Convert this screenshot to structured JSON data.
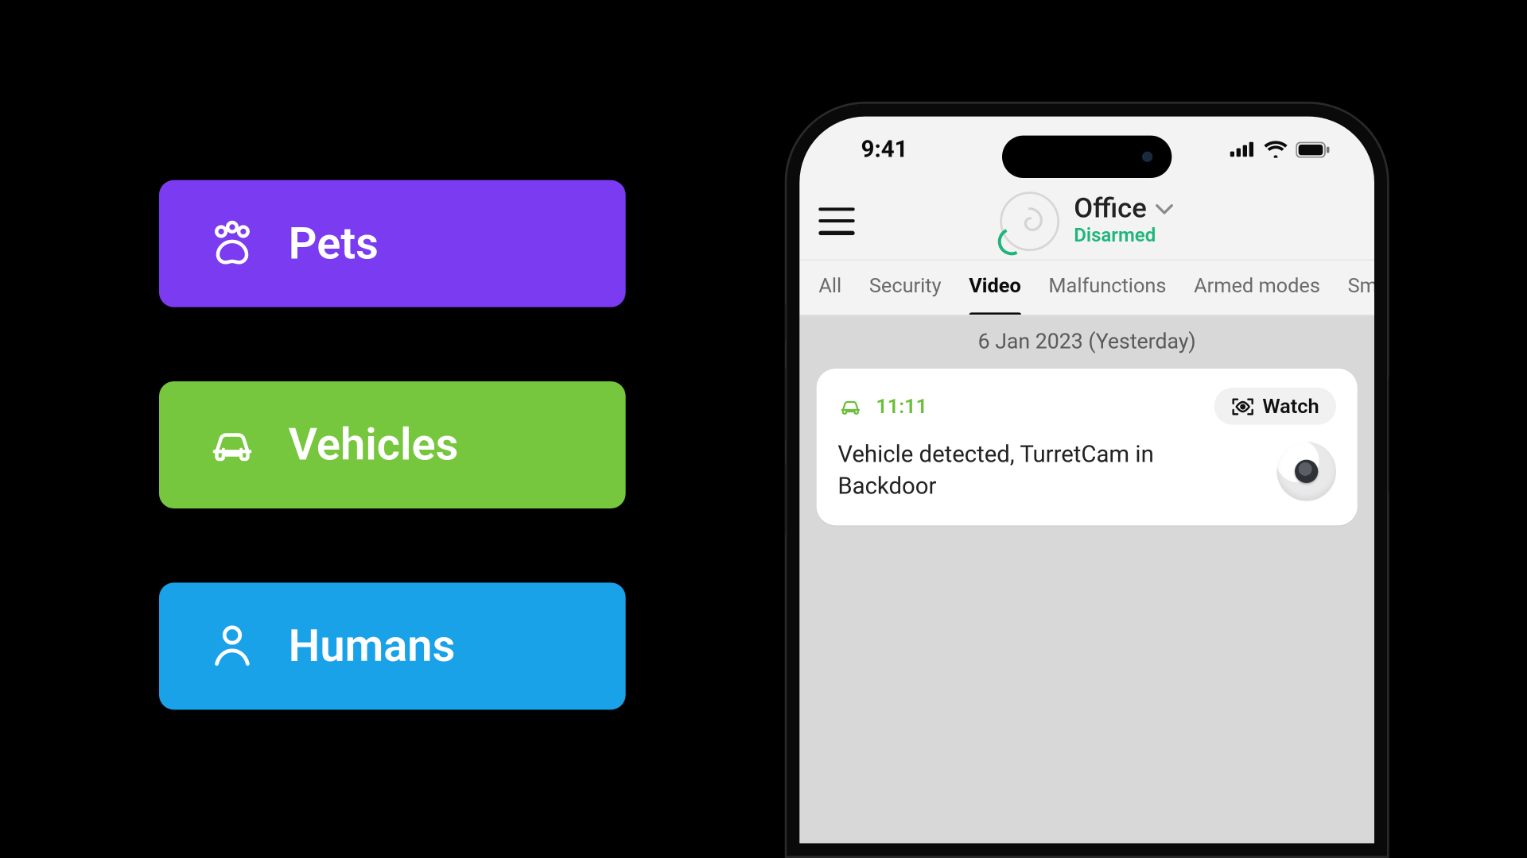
{
  "categories": [
    {
      "key": "pets",
      "label": "Pets",
      "color": "#7b3bf0",
      "icon": "paw-icon"
    },
    {
      "key": "vehicles",
      "label": "Vehicles",
      "color": "#76c63e",
      "icon": "car-icon"
    },
    {
      "key": "humans",
      "label": "Humans",
      "color": "#1aa2e8",
      "icon": "person-icon"
    }
  ],
  "phone": {
    "status": {
      "time": "9:41"
    },
    "header": {
      "location": "Office",
      "state": "Disarmed"
    },
    "tabs": [
      {
        "label": "All",
        "active": false
      },
      {
        "label": "Security",
        "active": false
      },
      {
        "label": "Video",
        "active": true
      },
      {
        "label": "Malfunctions",
        "active": false
      },
      {
        "label": "Armed modes",
        "active": false
      },
      {
        "label": "Sm",
        "active": false,
        "truncated": true
      }
    ],
    "feed": {
      "date_label": "6 Jan 2023 (Yesterday)",
      "events": [
        {
          "time": "11:11",
          "icon": "car-icon",
          "accent": "#6bbf3a",
          "text": "Vehicle detected, TurretCam in Backdoor",
          "watch_label": "Watch"
        }
      ]
    }
  }
}
